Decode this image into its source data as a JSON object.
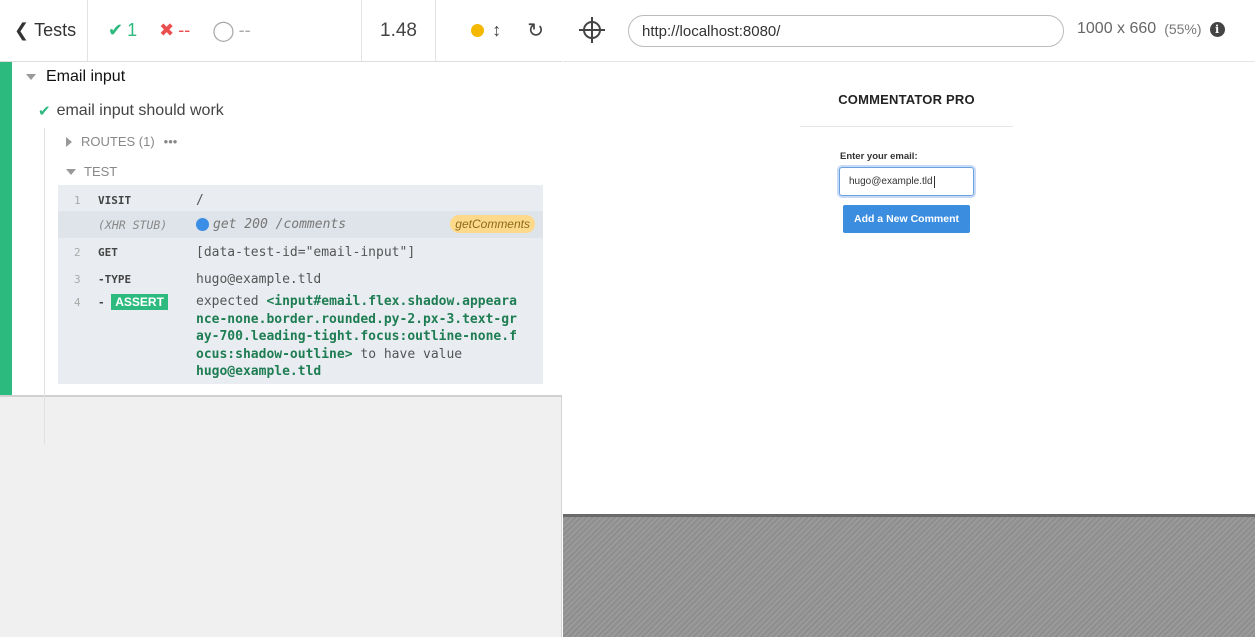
{
  "reporter": {
    "back_label": "Tests",
    "stats": {
      "passed": "1",
      "failed": "--",
      "pending": "--"
    },
    "duration": "1.48"
  },
  "runner": {
    "suite_title": "Email input",
    "test_title": "email input should work",
    "routes_label": "ROUTES (1)",
    "routes_more": "•••",
    "test_label": "TEST",
    "commands": [
      {
        "num": "1",
        "name": "VISIT",
        "message": "/"
      },
      {
        "num": "",
        "name": "(XHR STUB)",
        "message": "get 200 /comments",
        "alias": "getComments"
      },
      {
        "num": "2",
        "name": "GET",
        "message": "[data-test-id=\"email-input\"]"
      },
      {
        "num": "3",
        "name": "-TYPE",
        "message": "hugo@example.tld"
      },
      {
        "num": "4",
        "name": "-",
        "badge": "ASSERT",
        "message_expected": "expected",
        "message_subject": "<input#email.flex.shadow.appearance-none.border.rounded.py-2.px-3.text-gray-700.leading-tight.focus:outline-none.focus:shadow-outline>",
        "message_to_have": "to have value",
        "message_value": "hugo@example.tld"
      }
    ]
  },
  "aut": {
    "url": "http://localhost:8080/",
    "viewport": "1000 x 660",
    "scale": "(55%)",
    "app_title": "COMMENTATOR PRO",
    "email_label": "Enter your email:",
    "email_value": "hugo@example.tld",
    "button_label": "Add a New Comment"
  },
  "colors": {
    "pass": "#2dba7e",
    "fail": "#e94f4f",
    "accent_blue": "#3b8de0",
    "alias_bg": "#fdd98b"
  }
}
